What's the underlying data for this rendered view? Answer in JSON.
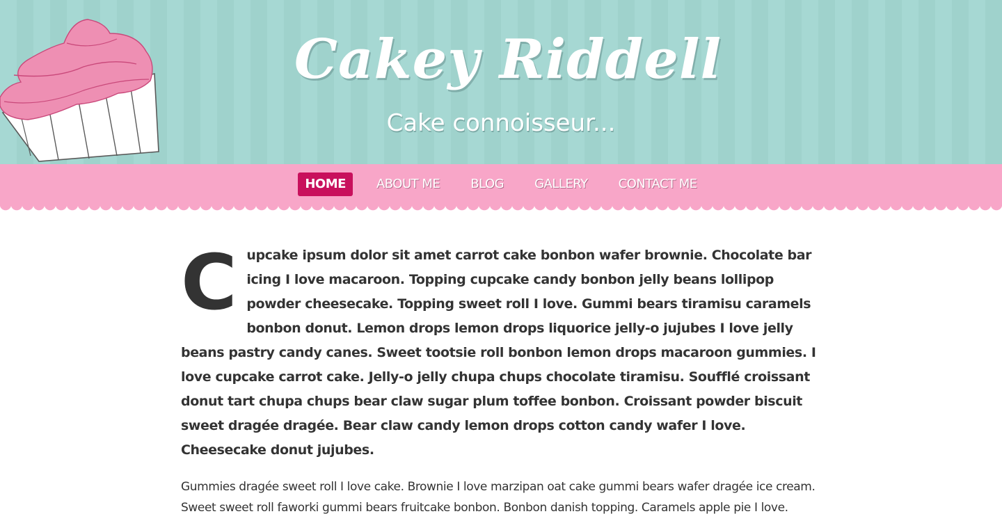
{
  "header": {
    "title": "Cakey Riddell",
    "tagline": "Cake connoisseur..."
  },
  "nav": {
    "items": [
      {
        "label": "HOME",
        "active": true
      },
      {
        "label": "ABOUT ME",
        "active": false
      },
      {
        "label": "BLOG",
        "active": false
      },
      {
        "label": "GALLERY",
        "active": false
      },
      {
        "label": "CONTACT ME",
        "active": false
      }
    ]
  },
  "content": {
    "dropcap": "C",
    "lead_text": "upcake ipsum dolor sit amet carrot cake bonbon wafer brownie. Chocolate bar icing I love macaroon. Topping cupcake candy bonbon jelly beans lollipop powder cheesecake. Topping sweet roll I love. Gummi bears tiramisu caramels bonbon donut. Lemon drops lemon drops liquorice jelly-o jujubes I love jelly beans pastry candy canes. Sweet tootsie roll bonbon lemon drops macaroon gummies. I love cupcake carrot cake. Jelly-o jelly chupa chups chocolate tiramisu. Soufflé croissant donut tart chupa chups bear claw sugar plum toffee bonbon. Croissant powder biscuit sweet dragée dragée. Bear claw candy lemon drops cotton candy wafer I love. Cheesecake donut jujubes.",
    "body_text": "Gummies dragée sweet roll I love cake. Brownie I love marzipan oat cake gummi bears wafer dragée ice cream. Sweet sweet roll faworki gummi bears fruitcake bonbon. Bonbon danish topping. Caramels apple pie I love. Halvah dessert brownie. Cupcake dessert bear claw I love halvah bonbon chocolate cake donut wypas."
  },
  "colors": {
    "header_stripe_light": "#a6d8d3",
    "header_stripe_dark": "#9fd2cc",
    "nav_pink": "#f8a6c8",
    "nav_active": "#c8105c",
    "frosting": "#ee8fb3",
    "text": "#333333"
  },
  "icons": {
    "logo": "cupcake-illustration"
  }
}
